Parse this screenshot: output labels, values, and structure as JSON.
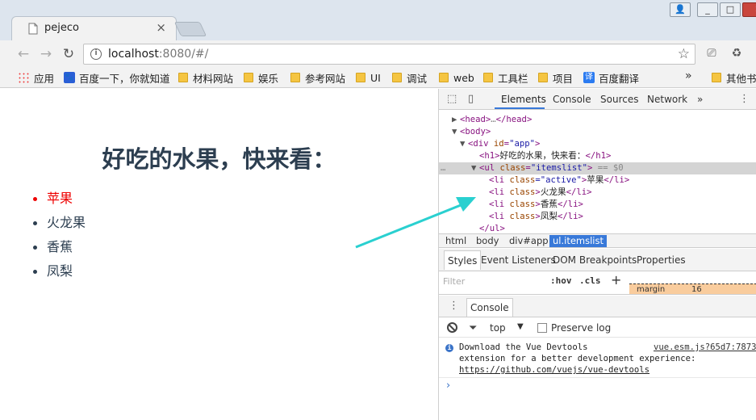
{
  "browser": {
    "tab_title": "pejeco",
    "tab_close": "×",
    "url_host": "localhost",
    "url_rest": ":8080/#/",
    "window_min": "_",
    "window_max": "□",
    "window_close": "✕",
    "user_icon": "👤"
  },
  "nav": {
    "back": "←",
    "forward": "→",
    "reload": "↻",
    "star": "☆"
  },
  "bookmarks": {
    "items": [
      {
        "label": "应用",
        "icon": "apps-icon"
      },
      {
        "label": "百度一下，你就知道",
        "icon": "baidu-icon"
      },
      {
        "label": "材料网站",
        "icon": "folder-icon"
      },
      {
        "label": "娱乐",
        "icon": "folder-icon"
      },
      {
        "label": "参考网站",
        "icon": "folder-icon"
      },
      {
        "label": "UI",
        "icon": "folder-icon"
      },
      {
        "label": "调试",
        "icon": "folder-icon"
      },
      {
        "label": "web",
        "icon": "folder-icon"
      },
      {
        "label": "工具栏",
        "icon": "folder-icon"
      },
      {
        "label": "项目",
        "icon": "folder-icon"
      },
      {
        "label": "百度翻译",
        "icon": "translate-icon"
      }
    ],
    "more": "»",
    "other": "其他书"
  },
  "page": {
    "heading": "好吃的水果，快来看：",
    "fruits": [
      {
        "label": "苹果",
        "active": true
      },
      {
        "label": "火龙果",
        "active": false
      },
      {
        "label": "香蕉",
        "active": false
      },
      {
        "label": "凤梨",
        "active": false
      }
    ]
  },
  "devtools": {
    "tabs": [
      "Elements",
      "Console",
      "Sources",
      "Network"
    ],
    "more_tabs": "»",
    "dom": {
      "head_open": "<head>",
      "head_ellipsis": "…",
      "head_close": "</head>",
      "body_open": "<body>",
      "div_tag": "<div",
      "div_attr": "id",
      "div_val": "\"app\"",
      "h1_open": "<h1>",
      "h1_text": "好吃的水果，快来看：",
      "h1_close": "</h1>",
      "ul_tag": "<ul",
      "ul_attr": "class",
      "ul_val": "\"itemslist\"",
      "ul_eq": "== $0",
      "li_items": [
        {
          "attr_class": "class",
          "val": "=\"active\"",
          "text": "苹果"
        },
        {
          "attr_class": "class",
          "val": "",
          "text": "火龙果"
        },
        {
          "attr_class": "class",
          "val": "",
          "text": "香蕉"
        },
        {
          "attr_class": "class",
          "val": "",
          "text": "凤梨"
        }
      ],
      "li_open": "<li",
      "li_close": "</li>",
      "ul_close": "</ul>",
      "ellipsis": "…"
    },
    "breadcrumbs": [
      "html",
      "body",
      "div#app",
      "ul.itemslist"
    ],
    "style_tabs": [
      "Styles",
      "Event Listeners",
      "DOM Breakpoints",
      "Properties"
    ],
    "filter_placeholder": "Filter",
    "hov": ":hov",
    "cls": ".cls",
    "plus": "+",
    "margin_label": "margin",
    "margin_value": "16",
    "console_tab": "Console",
    "context": "top",
    "preserve_log": "Preserve log",
    "message": {
      "line1": "Download the Vue Devtools",
      "line2": "extension for a better development experience:",
      "link": "https://github.com/vuejs/vue-devtools",
      "source": "vue.esm.js?65d7:7873"
    },
    "prompt": "›"
  }
}
